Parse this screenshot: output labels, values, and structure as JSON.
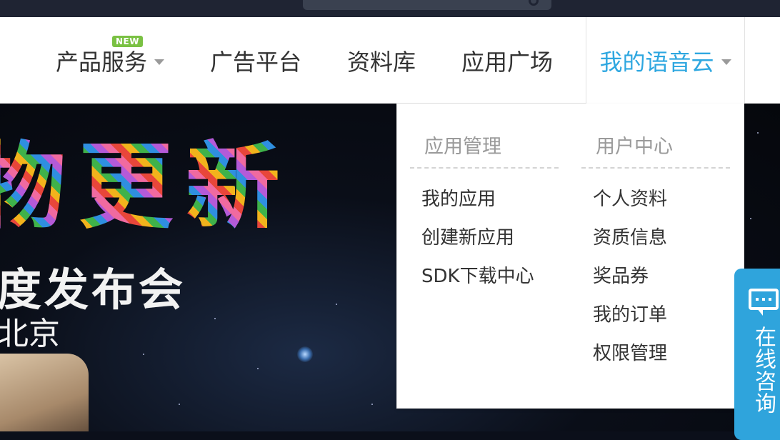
{
  "nav": {
    "items": [
      {
        "label": "产品服务",
        "has_caret": true,
        "badge": "NEW"
      },
      {
        "label": "广告平台"
      },
      {
        "label": "资料库"
      },
      {
        "label": "应用广场"
      },
      {
        "label": "我的语音云",
        "has_caret": true,
        "active": true
      }
    ]
  },
  "banner": {
    "headline": "物更新",
    "subtitle": "度发布会",
    "location": "北京"
  },
  "dropdown": {
    "app_management": {
      "title": "应用管理",
      "items": [
        "我的应用",
        "创建新应用",
        "SDK下载中心"
      ]
    },
    "user_center": {
      "title": "用户中心",
      "items": [
        "个人资料",
        "资质信息",
        "奖品券",
        "我的订单",
        "权限管理"
      ]
    }
  },
  "consult": {
    "label": "在线咨询"
  },
  "colors": {
    "accent": "#2ea7e0",
    "new_badge": "#7ac143",
    "consult_bg": "#2fa4dc"
  }
}
